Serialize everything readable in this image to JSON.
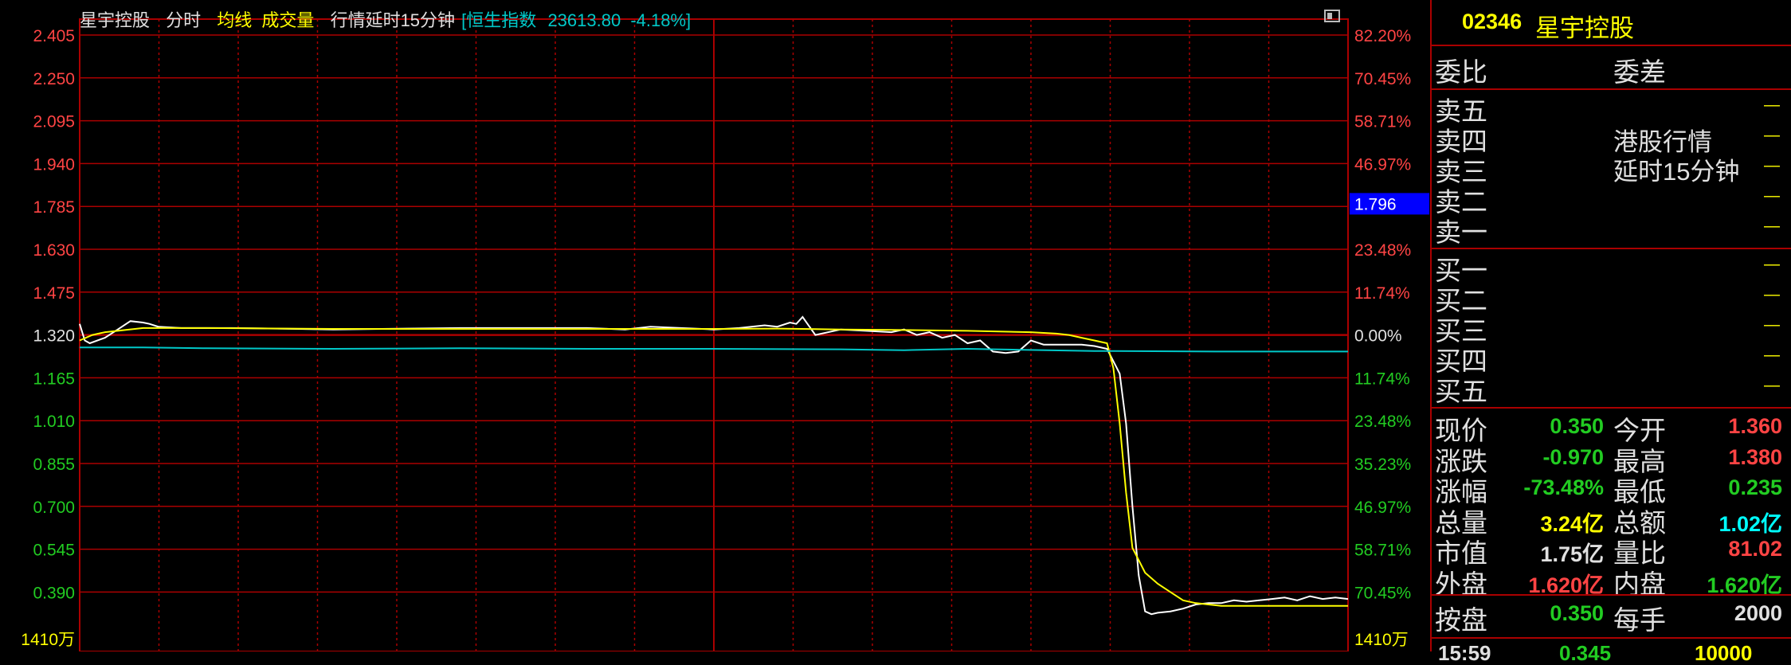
{
  "header": {
    "stock_name": "星宇控股",
    "tab_fenshi": "分时",
    "tab_junxian": "均线",
    "tab_volume": "成交量",
    "delay_notice": "行情延时15分钟",
    "index_name": "恒生指数",
    "index_value": "23613.80",
    "index_change": "-4.18%"
  },
  "chart_data": {
    "type": "line",
    "title": "",
    "prev_close": 1.32,
    "ylim": [
      0.31,
      2.405
    ],
    "y_ticks_left": [
      "2.405",
      "2.250",
      "2.095",
      "1.940",
      "1.785",
      "1.630",
      "1.475",
      "1.320",
      "1.165",
      "1.010",
      "0.855",
      "0.700",
      "0.545",
      "0.390"
    ],
    "y_ticks_right": [
      "82.20%",
      "70.45%",
      "58.71%",
      "46.97%",
      "35.23%",
      "23.48%",
      "11.74%",
      "0.00%",
      "11.74%",
      "23.48%",
      "35.23%",
      "46.97%",
      "58.71%",
      "70.45%"
    ],
    "volume_label_left": "1410万",
    "volume_label_right": "1410万",
    "cursor_price": "1.796",
    "x_range": [
      0,
      1
    ],
    "series": [
      {
        "role": "price",
        "color": "#ffffff",
        "x": [
          0,
          0.004,
          0.008,
          0.02,
          0.03,
          0.04,
          0.05,
          0.055,
          0.062,
          0.08,
          0.12,
          0.2,
          0.3,
          0.4,
          0.43,
          0.45,
          0.5,
          0.52,
          0.54,
          0.55,
          0.56,
          0.565,
          0.57,
          0.58,
          0.6,
          0.62,
          0.64,
          0.65,
          0.66,
          0.67,
          0.68,
          0.69,
          0.7,
          0.71,
          0.72,
          0.73,
          0.74,
          0.75,
          0.76,
          0.77,
          0.78,
          0.79,
          0.8,
          0.81,
          0.82,
          0.825,
          0.83,
          0.835,
          0.84,
          0.845,
          0.85,
          0.86,
          0.87,
          0.88,
          0.89,
          0.9,
          0.91,
          0.92,
          0.93,
          0.94,
          0.95,
          0.96,
          0.97,
          0.98,
          0.99,
          1.0
        ],
        "y": [
          1.36,
          1.3,
          1.29,
          1.31,
          1.34,
          1.37,
          1.365,
          1.36,
          1.35,
          1.345,
          1.345,
          1.34,
          1.345,
          1.345,
          1.34,
          1.35,
          1.34,
          1.345,
          1.355,
          1.35,
          1.365,
          1.36,
          1.385,
          1.32,
          1.34,
          1.335,
          1.33,
          1.34,
          1.32,
          1.33,
          1.31,
          1.32,
          1.29,
          1.3,
          1.26,
          1.255,
          1.26,
          1.3,
          1.285,
          1.285,
          1.285,
          1.285,
          1.28,
          1.27,
          1.18,
          1.0,
          0.7,
          0.45,
          0.32,
          0.31,
          0.315,
          0.32,
          0.33,
          0.345,
          0.35,
          0.35,
          0.36,
          0.355,
          0.36,
          0.365,
          0.37,
          0.36,
          0.375,
          0.365,
          0.37,
          0.365
        ]
      },
      {
        "role": "average",
        "color": "#ffff00",
        "x": [
          0,
          0.01,
          0.02,
          0.05,
          0.1,
          0.2,
          0.3,
          0.4,
          0.5,
          0.55,
          0.6,
          0.65,
          0.7,
          0.75,
          0.77,
          0.78,
          0.79,
          0.8,
          0.81,
          0.815,
          0.82,
          0.825,
          0.83,
          0.84,
          0.85,
          0.86,
          0.87,
          0.88,
          0.89,
          0.9,
          0.95,
          1.0
        ],
        "y": [
          1.3,
          1.32,
          1.33,
          1.345,
          1.345,
          1.342,
          1.342,
          1.342,
          1.342,
          1.343,
          1.34,
          1.338,
          1.335,
          1.33,
          1.325,
          1.32,
          1.31,
          1.3,
          1.29,
          1.2,
          1.0,
          0.75,
          0.55,
          0.46,
          0.42,
          0.39,
          0.36,
          0.35,
          0.345,
          0.34,
          0.34,
          0.34
        ]
      },
      {
        "role": "index",
        "color": "#00c8c8",
        "x": [
          0,
          0.05,
          0.1,
          0.2,
          0.3,
          0.4,
          0.5,
          0.6,
          0.65,
          0.7,
          0.8,
          0.9,
          1.0
        ],
        "y": [
          1.275,
          1.275,
          1.272,
          1.27,
          1.272,
          1.27,
          1.27,
          1.268,
          1.265,
          1.27,
          1.262,
          1.26,
          1.26
        ]
      }
    ]
  },
  "panel": {
    "code": "02346",
    "name": "星宇控股",
    "weibi": "委比",
    "weicha": "委差",
    "notice_line1": "港股行情",
    "notice_line2": "延时15分钟",
    "sell_levels": [
      "卖五",
      "卖四",
      "卖三",
      "卖二",
      "卖一"
    ],
    "buy_levels": [
      "买一",
      "买二",
      "买三",
      "买四",
      "买五"
    ],
    "empty": "—",
    "quotes": [
      {
        "l1": "现价",
        "v1": "0.350",
        "c1": "#22cc22",
        "l2": "今开",
        "v2": "1.360",
        "c2": "#ff4444"
      },
      {
        "l1": "涨跌",
        "v1": "-0.970",
        "c1": "#22cc22",
        "l2": "最高",
        "v2": "1.380",
        "c2": "#ff4444"
      },
      {
        "l1": "涨幅",
        "v1": "-73.48%",
        "c1": "#22cc22",
        "l2": "最低",
        "v2": "0.235",
        "c2": "#22cc22"
      },
      {
        "l1": "总量",
        "v1": "3.24亿",
        "c1": "#ffff00",
        "l2": "总额",
        "v2": "1.02亿",
        "c2": "#00ffff"
      },
      {
        "l1": "市值",
        "v1": "1.75亿",
        "c1": "#e0e0e0",
        "l2": "量比",
        "v2": "81.02",
        "c2": "#ff4444"
      },
      {
        "l1": "外盘",
        "v1": "1.620亿",
        "c1": "#ff4444",
        "l2": "内盘",
        "v2": "1.620亿",
        "c2": "#22cc22"
      }
    ],
    "anpan_label": "按盘",
    "anpan_value": "0.350",
    "meishou_label": "每手",
    "meishou_value": "2000",
    "tick_time": "15:59",
    "tick_price": "0.345",
    "tick_volume": "10000"
  }
}
